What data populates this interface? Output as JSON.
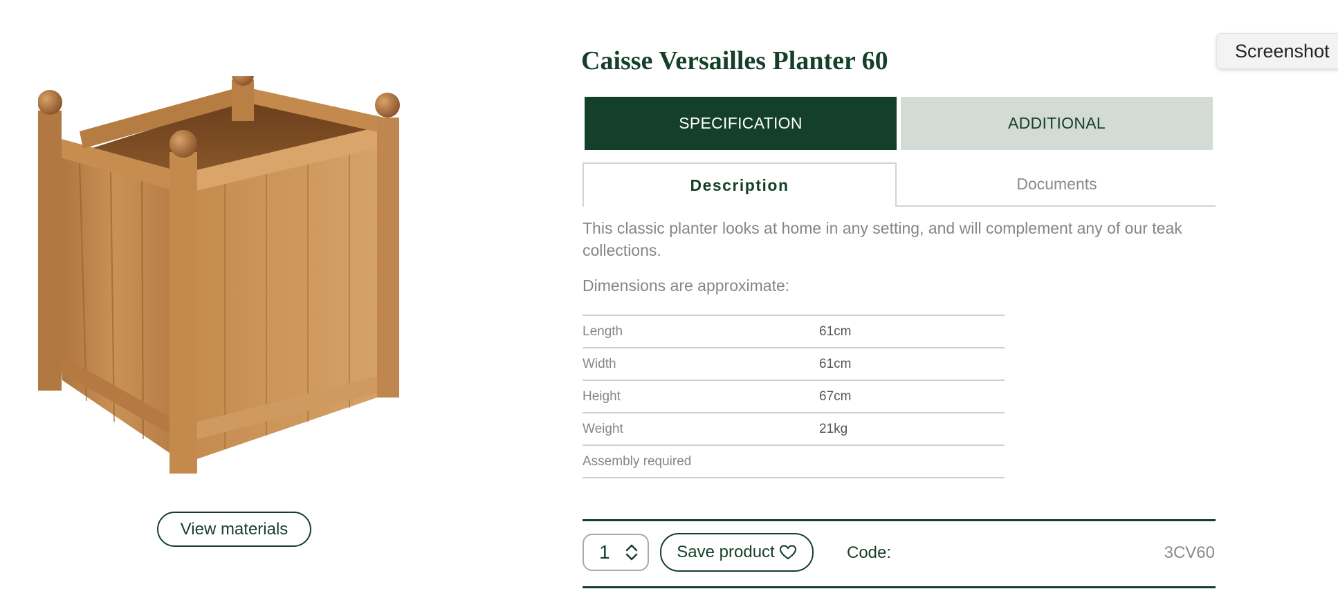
{
  "product": {
    "title": "Caisse Versailles Planter 60",
    "image_alt": "teak planter"
  },
  "view_materials_label": "View materials",
  "main_tabs": [
    {
      "label": "SPECIFICATION",
      "active": true
    },
    {
      "label": "ADDITIONAL",
      "active": false
    }
  ],
  "sub_tabs": [
    {
      "label": "Description",
      "active": true
    },
    {
      "label": "Documents",
      "active": false
    }
  ],
  "description": {
    "text": "This classic planter looks at home in any setting, and will complement any of our teak collections.",
    "dimensions_heading": "Dimensions are approximate:"
  },
  "specs": [
    {
      "label": "Length",
      "value": "61cm"
    },
    {
      "label": "Width",
      "value": "61cm"
    },
    {
      "label": "Height",
      "value": "67cm"
    },
    {
      "label": "Weight",
      "value": "21kg"
    },
    {
      "label": "Assembly required",
      "value": ""
    }
  ],
  "cart": {
    "quantity": "1",
    "save_label": "Save product",
    "code_label": "Code:",
    "code_value": "3CV60"
  },
  "tooltip": {
    "label": "Screenshot"
  },
  "icons": {
    "stepper": "chevron-up-down-icon",
    "save": "heart-icon"
  },
  "colors": {
    "brand_green": "#143f28",
    "inactive_tab": "#d4dad4",
    "teak": "#c08a4e"
  }
}
